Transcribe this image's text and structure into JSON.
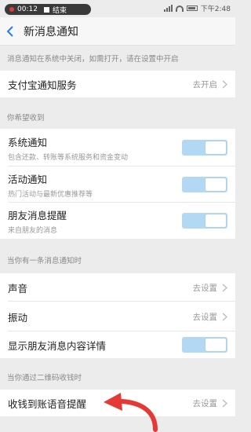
{
  "status_bar": {
    "recording_time": "00:12",
    "recording_end": "结束",
    "time": "下午2:48"
  },
  "nav": {
    "title": "新消息通知"
  },
  "notice": "消息通知在系统中关闭，如需打开，请在设置中开启",
  "alipay_row": {
    "title": "支付宝通知服务",
    "action": "去开启"
  },
  "section_receive": {
    "header": "你希望收到",
    "items": [
      {
        "title": "系统通知",
        "subtitle": "包含还款、转账等系统服务和资金变动",
        "enabled": true
      },
      {
        "title": "活动通知",
        "subtitle": "热门活动与最新优惠推荐等",
        "enabled": true
      },
      {
        "title": "朋友消息提醒",
        "subtitle": "来自朋友的消息",
        "enabled": true
      }
    ]
  },
  "section_when": {
    "header": "当你有一条消息通知时",
    "items": [
      {
        "title": "声音",
        "action": "去设置"
      },
      {
        "title": "振动",
        "action": "去设置"
      },
      {
        "title": "显示朋友消息内容详情",
        "enabled": true
      }
    ]
  },
  "section_qr": {
    "header": "当你通过二维码收钱时",
    "items": [
      {
        "title": "收钱到账语音提醒",
        "action": "去设置"
      }
    ]
  },
  "colors": {
    "toggle_on": "#b3d8f3",
    "back_arrow": "#2a7de1",
    "annotation_arrow": "#e53935"
  }
}
